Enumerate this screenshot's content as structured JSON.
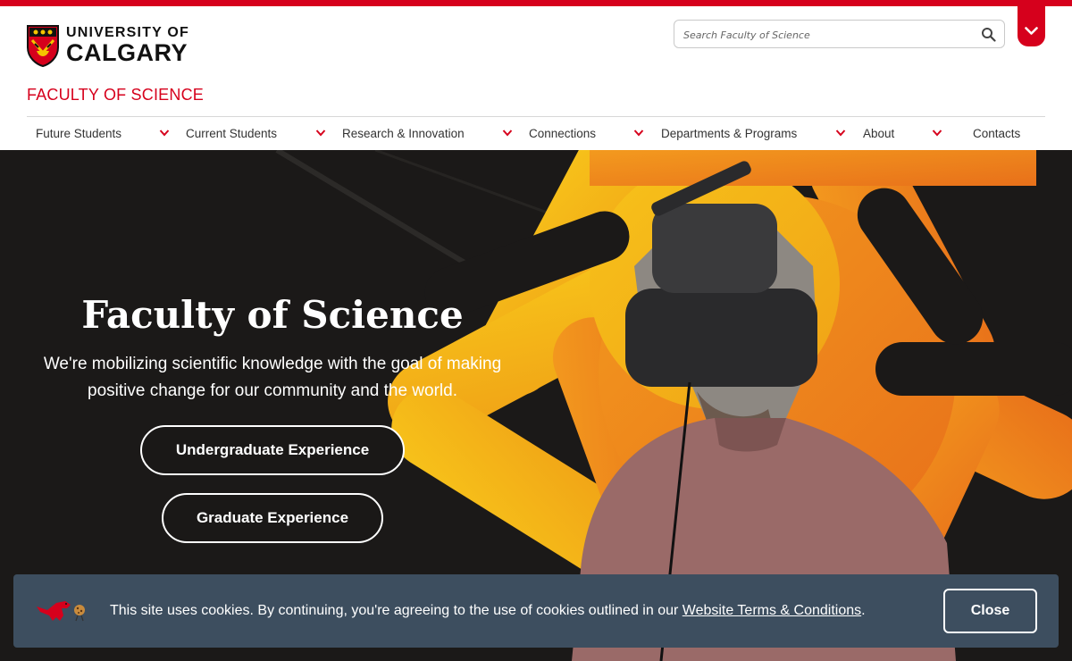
{
  "brand": {
    "line1": "UNIVERSITY OF",
    "line2": "CALGARY",
    "accent": "#d6001c"
  },
  "search": {
    "placeholder": "Search Faculty of Science",
    "icon": "search-icon"
  },
  "faculty_title": "FACULTY OF SCIENCE",
  "nav": {
    "items": [
      {
        "label": "Future Students",
        "has_dropdown": true
      },
      {
        "label": "Current Students",
        "has_dropdown": true
      },
      {
        "label": "Research & Innovation",
        "has_dropdown": true
      },
      {
        "label": "Connections",
        "has_dropdown": true
      },
      {
        "label": "Departments & Programs",
        "has_dropdown": true
      },
      {
        "label": "About",
        "has_dropdown": true
      },
      {
        "label": "Contacts",
        "has_dropdown": false
      }
    ]
  },
  "hero": {
    "title": "Faculty of Science",
    "subtitle_line1": "We're mobilizing scientific knowledge with the goal of making",
    "subtitle_line2": "positive change for our community and the world.",
    "buttons": [
      {
        "label": "Undergraduate Experience"
      },
      {
        "label": "Graduate Experience"
      }
    ]
  },
  "cookie": {
    "text": "This site uses cookies. By continuing, you're agreeing to the use of cookies outlined in our ",
    "link": "Website Terms & Conditions",
    "end": ".",
    "close_label": "Close",
    "background": "#3d4e5f"
  }
}
